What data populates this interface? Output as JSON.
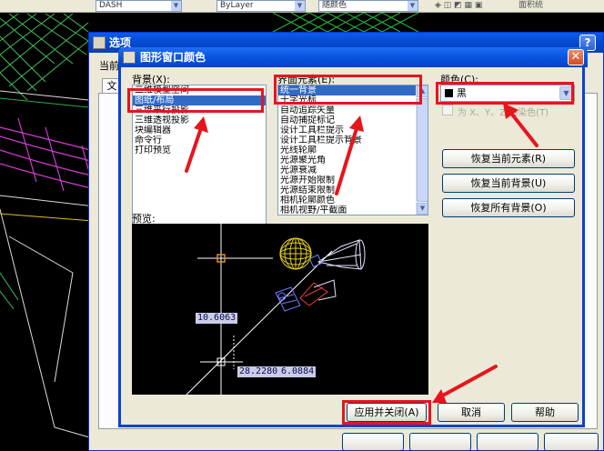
{
  "background_toolbar": {
    "linetype_field": "DASH",
    "lineweight_field": "ByLayer",
    "plotstyle_field": "随颜色",
    "area_label": "面积统"
  },
  "back_window": {
    "title": "选项",
    "help_glyph": "?",
    "current_label": "当前",
    "tab_label": "文"
  },
  "dialog": {
    "title": "图形窗口颜色",
    "close_glyph": "✕",
    "context_label": "背景(X):",
    "context_items": [
      "二维模型空间",
      "图纸/布局",
      "三维平行投影",
      "三维透视投影",
      "块编辑器",
      "命令行",
      "打印预览"
    ],
    "context_selected_index": 1,
    "element_label": "界面元素(E):",
    "element_items": [
      "统一背景",
      "十字光标",
      "自动追踪矢量",
      "自动捕捉标记",
      "设计工具栏提示",
      "设计工具栏提示背景",
      "光线轮廓",
      "光源聚光角",
      "光源衰减",
      "光源开始限制",
      "光源结束限制",
      "相机轮廓颜色",
      "相机视野/平截面"
    ],
    "element_selected_index": 0,
    "color_label": "颜色(C):",
    "color_value": "黑",
    "color_swatch": "#000000",
    "tint_checkbox_label": "为 X、Y、Z 轴染色(T)",
    "tint_checkbox_checked": false,
    "restore_element_button": "恢复当前元素(R)",
    "restore_context_button": "恢复当前背景(U)",
    "restore_all_button": "恢复所有背景(O)",
    "preview_label": "预览:",
    "preview_coords": [
      "10.6063",
      "28.2280",
      "6.0884"
    ],
    "apply_button": "应用并关闭(A)",
    "cancel_button": "取消",
    "help_button": "帮助"
  },
  "colors": {
    "highlight_red": "#e8141c",
    "selection_blue": "#316ac5",
    "titlebar_blue": "#0652de"
  }
}
